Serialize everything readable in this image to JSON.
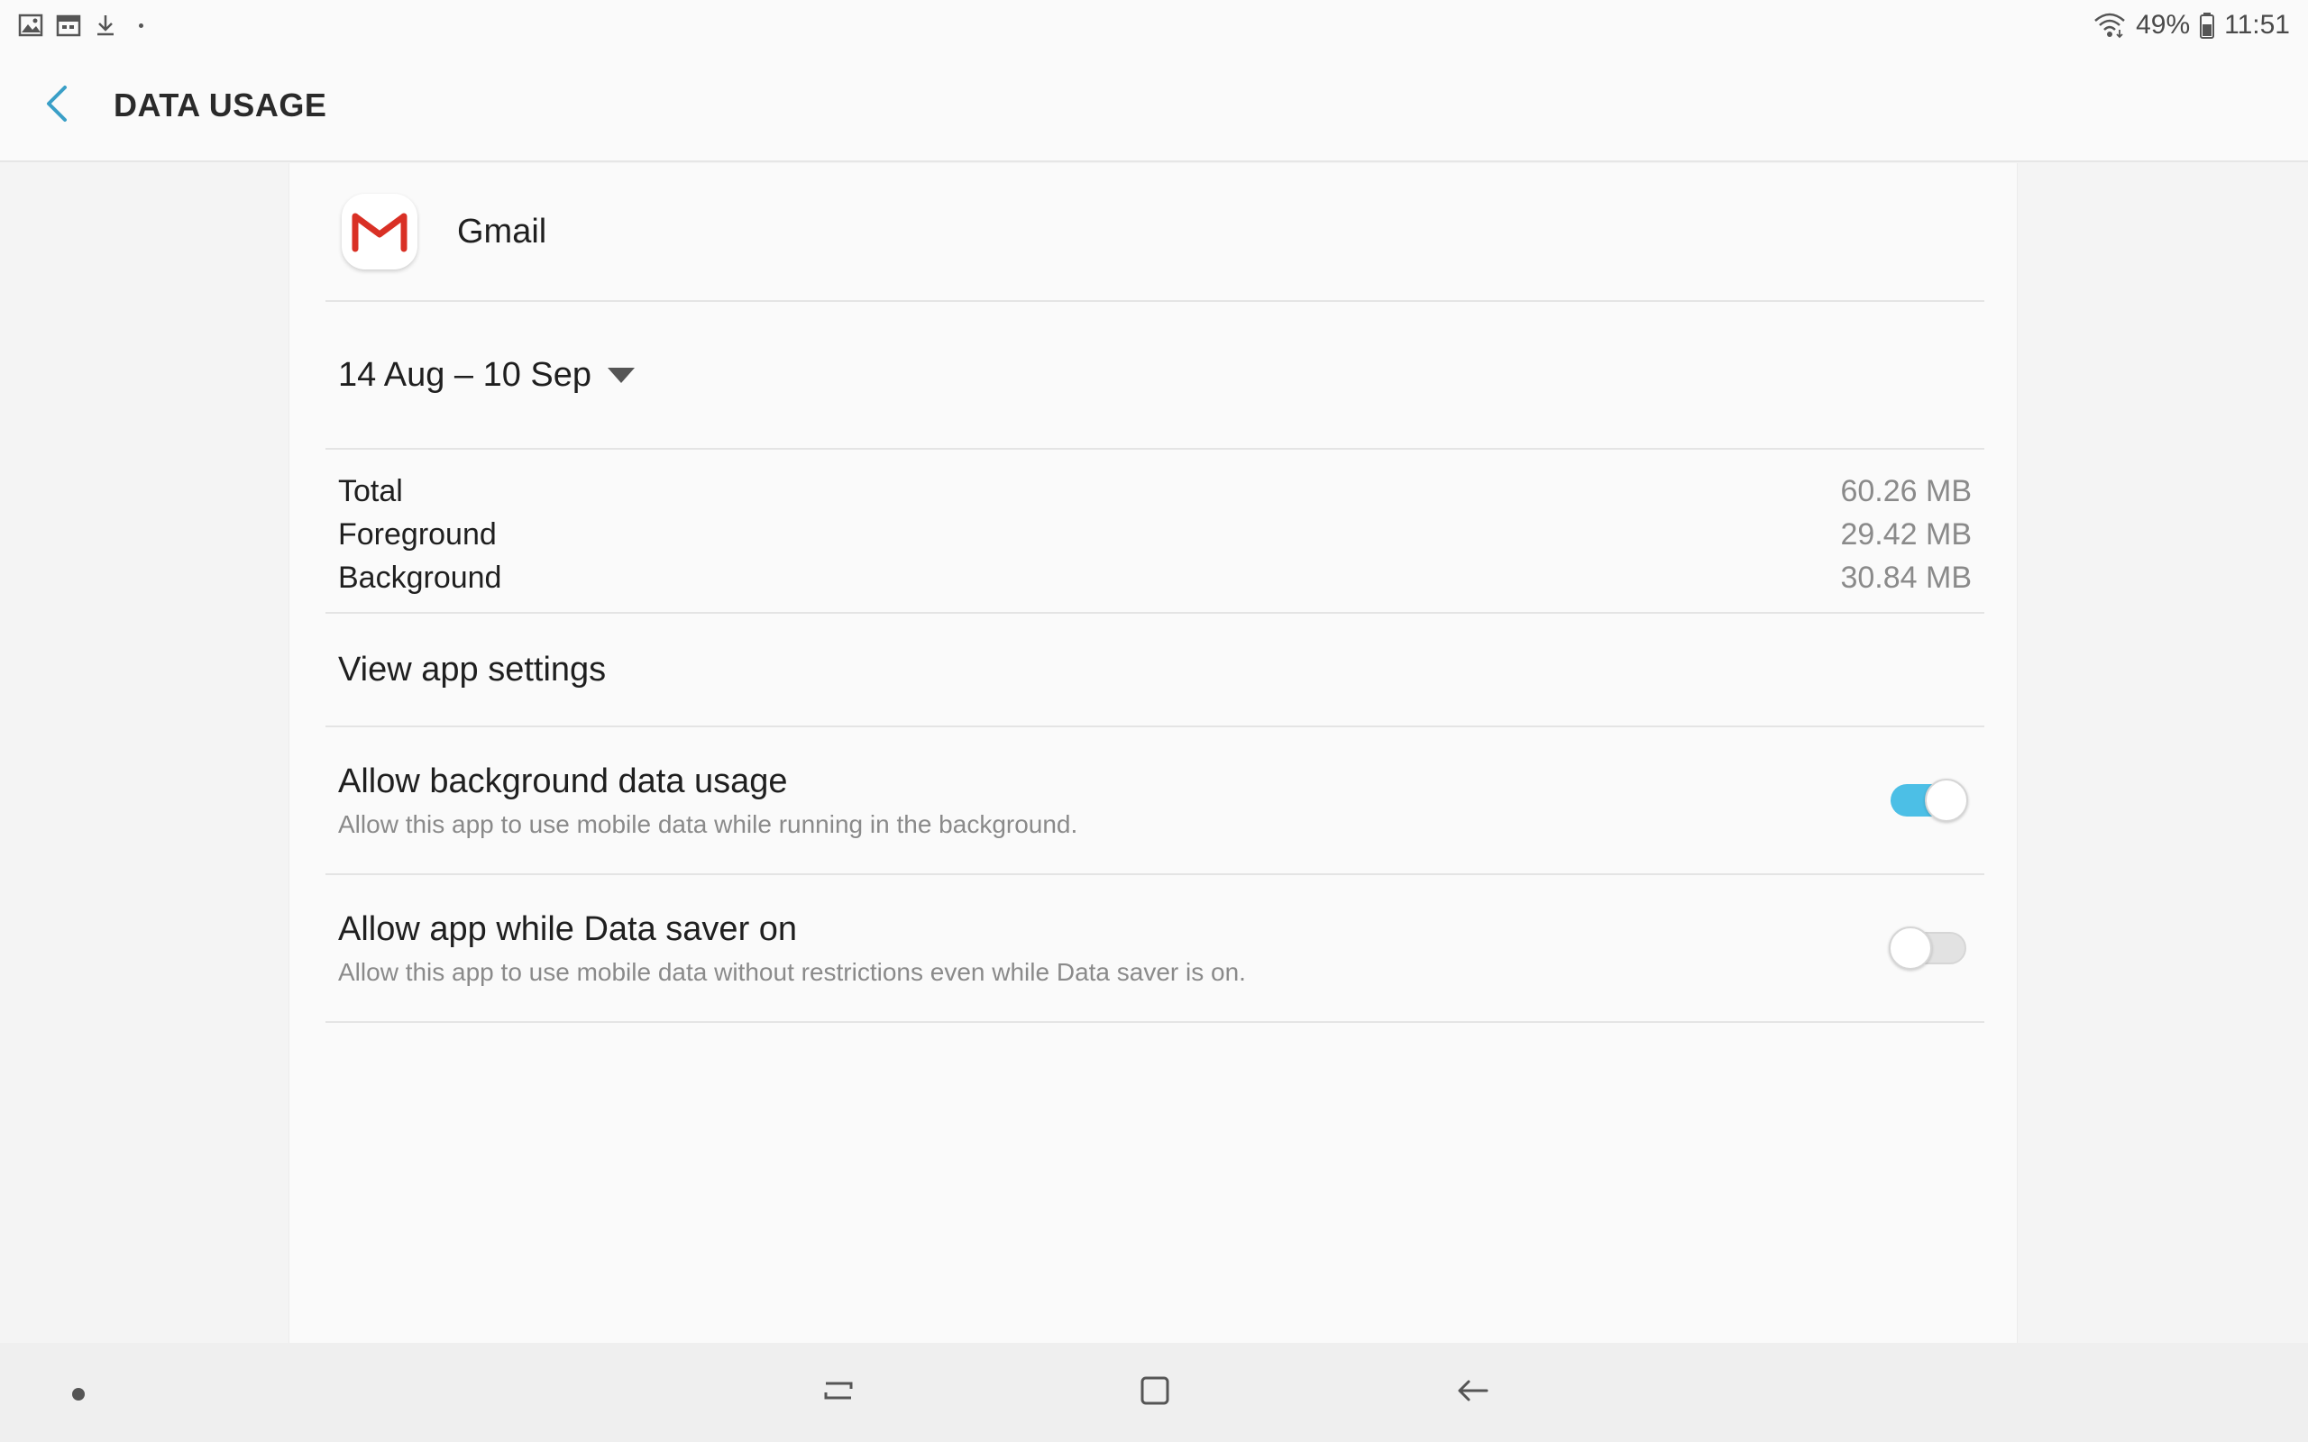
{
  "status_bar": {
    "battery_percent": "49%",
    "time": "11:51",
    "left_icons": [
      "gallery-icon",
      "calendar-icon",
      "download-icon"
    ],
    "right_icons": [
      "wifi-icon",
      "battery-icon"
    ]
  },
  "app_bar": {
    "title": "DATA USAGE",
    "back_icon": "chevron-left-icon"
  },
  "app": {
    "name": "Gmail",
    "icon": "gmail-icon"
  },
  "period": {
    "label": "14 Aug – 10 Sep"
  },
  "usage": [
    {
      "label": "Total",
      "value": "60.26 MB"
    },
    {
      "label": "Foreground",
      "value": "29.42 MB"
    },
    {
      "label": "Background",
      "value": "30.84 MB"
    }
  ],
  "view_settings": {
    "label": "View app settings"
  },
  "switches": [
    {
      "title": "Allow background data usage",
      "description": "Allow this app to use mobile data while running in the background.",
      "state": "on"
    },
    {
      "title": "Allow app while Data saver on",
      "description": "Allow this app to use mobile data without restrictions even while Data saver is on.",
      "state": "off"
    }
  ],
  "colors": {
    "accent": "#4cbfe6",
    "back_arrow": "#3a9fc7",
    "gmail_red": "#d93025"
  },
  "nav_bar": {
    "icons": [
      "recents-icon",
      "home-icon",
      "back-icon"
    ]
  }
}
